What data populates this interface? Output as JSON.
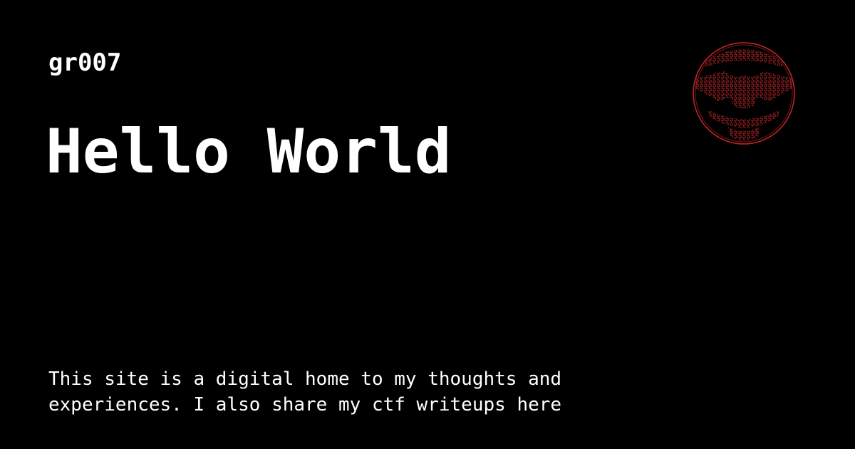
{
  "header": {
    "site_name": "gr007"
  },
  "main": {
    "title": "Hello World",
    "description_lines": [
      "This site is a digital home to my thoughts and",
      "experiences. I also share my ctf writeups here"
    ]
  },
  "logo": {
    "icon": "maze-smiley-logo-icon",
    "color": "#c62828"
  },
  "colors": {
    "background": "#000000",
    "text": "#ffffff",
    "accent": "#c62828"
  }
}
